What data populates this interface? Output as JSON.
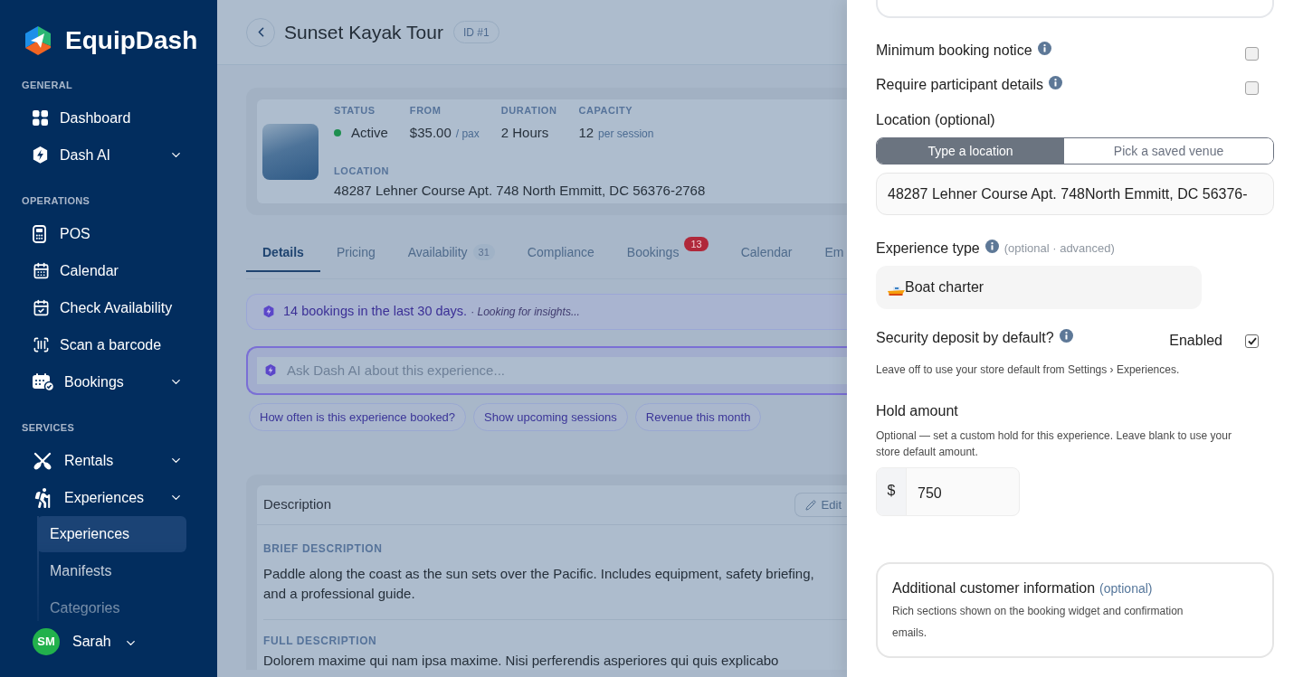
{
  "sidebar": {
    "brand": "EquipDash",
    "sections": [
      {
        "heading": "GENERAL",
        "items": [
          {
            "label": "Dashboard",
            "expandable": false
          },
          {
            "label": "Dash AI",
            "expandable": true
          }
        ]
      },
      {
        "heading": "OPERATIONS",
        "items": [
          {
            "label": "POS",
            "expandable": false
          },
          {
            "label": "Calendar",
            "expandable": false
          },
          {
            "label": "Check Availability",
            "expandable": false
          },
          {
            "label": "Scan a barcode",
            "expandable": false
          },
          {
            "label": "Bookings",
            "expandable": true
          }
        ]
      },
      {
        "heading": "SERVICES",
        "items": [
          {
            "label": "Rentals",
            "expandable": true
          },
          {
            "label": "Experiences",
            "expandable": true,
            "children": [
              {
                "label": "Experiences",
                "selected": true
              },
              {
                "label": "Manifests",
                "selected": false
              },
              {
                "label": "Categories",
                "selected": false
              }
            ]
          }
        ]
      }
    ],
    "user": {
      "initials": "SM",
      "name": "Sarah"
    }
  },
  "header": {
    "title": "Sunset Kayak Tour",
    "id_badge": "ID #1"
  },
  "summary": {
    "fields": [
      {
        "label": "STATUS",
        "value": "Active",
        "kind": "status",
        "color": "#1e8f4f"
      },
      {
        "label": "FROM",
        "value": "$35.00",
        "unit": "/ pax",
        "kind": "text"
      },
      {
        "label": "DURATION",
        "value": "2 Hours",
        "kind": "text"
      },
      {
        "label": "CAPACITY",
        "value": "12",
        "unit": "per session",
        "kind": "text"
      }
    ],
    "location": {
      "label": "LOCATION",
      "value": "48287 Lehner Course Apt. 748 North Emmitt, DC 56376-2768"
    }
  },
  "tabs": [
    {
      "label": "Details",
      "selected": true
    },
    {
      "label": "Pricing",
      "selected": false
    },
    {
      "label": "Availability",
      "count": "31",
      "selected": false
    },
    {
      "label": "Compliance",
      "selected": false
    },
    {
      "label": "Bookings",
      "badge": "13",
      "selected": false
    },
    {
      "label": "Calendar",
      "selected": false
    },
    {
      "label": "Em",
      "selected": false
    }
  ],
  "insight": {
    "text": "14 bookings in the last 30 days.",
    "note": "· *Looking for insights...*"
  },
  "ask": {
    "placeholder": "Ask Dash AI about this experience..."
  },
  "suggestions": [
    "How often is this experience booked?",
    "Show upcoming sessions",
    "Revenue this month"
  ],
  "description": {
    "title": "Description",
    "edit_label": "Edit",
    "sections": [
      {
        "heading": "BRIEF DESCRIPTION",
        "text": "Paddle along the coast as the sun sets over the Pacific. Includes equipment, safety briefing, and a professional guide."
      },
      {
        "heading": "FULL DESCRIPTION",
        "text": "Dolorem maxime qui nam ipsa maxime. Nisi perferendis asperiores qui quis explicabo"
      }
    ]
  },
  "panel": {
    "toggles": [
      {
        "label": "Minimum booking notice",
        "checked": false
      },
      {
        "label": "Require participant details",
        "checked": false
      }
    ],
    "location": {
      "label": "Location (optional)",
      "modes": [
        {
          "label": "Type a location",
          "selected": true
        },
        {
          "label": "Pick a saved venue",
          "selected": false
        }
      ],
      "value": "48287 Lehner Course Apt. 748North Emmitt, DC 56376-"
    },
    "experience_type": {
      "label": "Experience type",
      "hint": "(optional · advanced)",
      "value": "Boat charter"
    },
    "security_deposit": {
      "label": "Security deposit by default?",
      "state_label": "Enabled",
      "checked": true,
      "help": "Leave off to use your store default from Settings › Experiences."
    },
    "hold_amount": {
      "label": "Hold amount",
      "help": "Optional — set a custom hold for this experience. Leave blank to use your store default amount.",
      "currency": "$",
      "value": "750"
    },
    "additional_info": {
      "title": "Additional customer information",
      "hint": "(optional)",
      "text": "Rich sections shown on the booking widget and confirmation emails."
    }
  }
}
